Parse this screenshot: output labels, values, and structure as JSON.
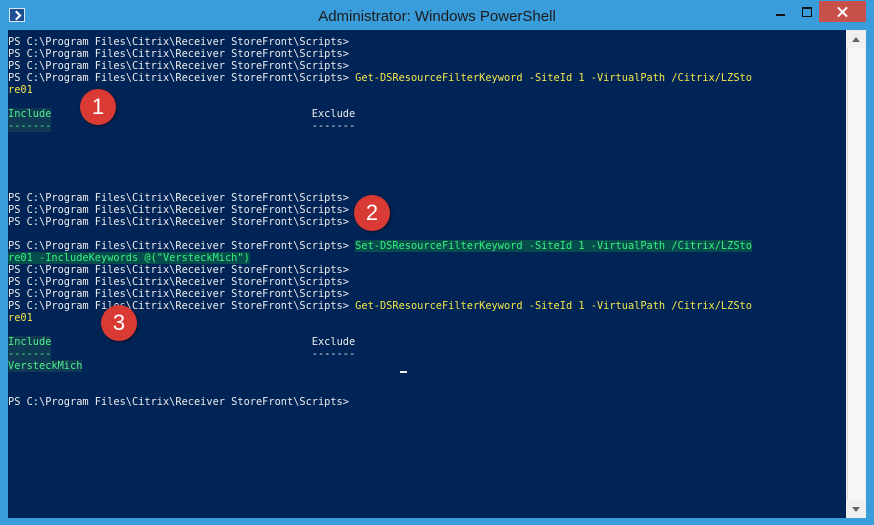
{
  "window": {
    "title": "Administrator: Windows PowerShell"
  },
  "console": {
    "prompt": "PS C:\\Program Files\\Citrix\\Receiver StoreFront\\Scripts> ",
    "commands": {
      "get_filter_keyword_1": "Get-DSResourceFilterKeyword -SiteId 1 -VirtualPath /Citrix/LZSto",
      "get_filter_keyword_1_wrap": "re01",
      "set_filter_keyword": "Set-DSResourceFilterKeyword -SiteId 1 -VirtualPath /Citrix/LZSto",
      "set_filter_keyword_wrap": "re01 -IncludeKeywords @(\"VersteckMich\")",
      "get_filter_keyword_2": "Get-DSResourceFilterKeyword -SiteId 1 -VirtualPath /Citrix/LZSto",
      "get_filter_keyword_2_wrap": "re01"
    },
    "output": {
      "include_header": "Include",
      "exclude_header": "Exclude",
      "separator": "-------",
      "include_value": "VersteckMich"
    }
  },
  "annotations": {
    "marker_1": "1",
    "marker_2": "2",
    "marker_3": "3"
  },
  "colors": {
    "console_background": "#012456",
    "console_text": "#eeedf0",
    "command_text": "#f3e64a",
    "highlight_text": "#33f27e",
    "titlebar": "#3a9ddb",
    "close_button": "#c7504b",
    "marker": "#d93a33"
  },
  "icons": {
    "app": "powershell-icon",
    "minimize": "minimize-icon",
    "maximize": "maximize-icon",
    "close": "close-icon",
    "scroll_up": "scroll-up-arrow-icon",
    "scroll_down": "scroll-down-arrow-icon"
  }
}
